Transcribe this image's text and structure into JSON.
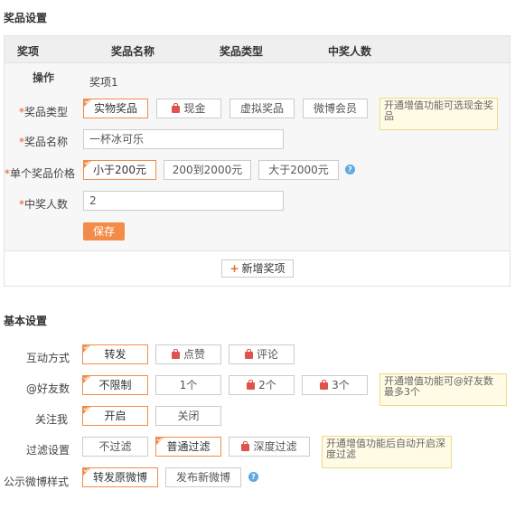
{
  "prize_section": {
    "title": "奖品设置",
    "headers": [
      "奖项",
      "奖品名称",
      "奖品类型",
      "中奖人数"
    ],
    "row_label": "操作",
    "row_value": "奖项1",
    "type_label": "奖品类型",
    "type_options": [
      "实物奖品",
      "现金",
      "虚拟奖品",
      "微博会员"
    ],
    "type_tip": "开通增值功能可选现金奖品",
    "name_label": "奖品名称",
    "name_value": "一杯冰可乐",
    "price_label": "单个奖品价格",
    "price_options": [
      "小于200元",
      "200到2000元",
      "大于2000元"
    ],
    "count_label": "中奖人数",
    "count_value": "2",
    "save_label": "保存",
    "add_label": "新增奖项",
    "required_mark": "*",
    "help_glyph": "?"
  },
  "basic_section": {
    "title": "基本设置",
    "interact_label": "互动方式",
    "interact_options": [
      "转发",
      "点赞",
      "评论"
    ],
    "friends_label": "@好友数",
    "friends_options": [
      "不限制",
      "1个",
      "2个",
      "3个"
    ],
    "friends_tip": "开通增值功能可@好友数最多3个",
    "follow_label": "关注我",
    "follow_options": [
      "开启",
      "关闭"
    ],
    "filter_label": "过滤设置",
    "filter_options": [
      "不过滤",
      "普通过滤",
      "深度过滤"
    ],
    "filter_tip": "开通增值功能后自动开启深度过滤",
    "style_label": "公示微博样式",
    "style_options": [
      "转发原微博",
      "发布新微博"
    ]
  },
  "colors": {
    "accent": "#f28c48",
    "lock": "#e0534a",
    "tip_bg": "#fffbe5",
    "help": "#5fa8e0"
  }
}
